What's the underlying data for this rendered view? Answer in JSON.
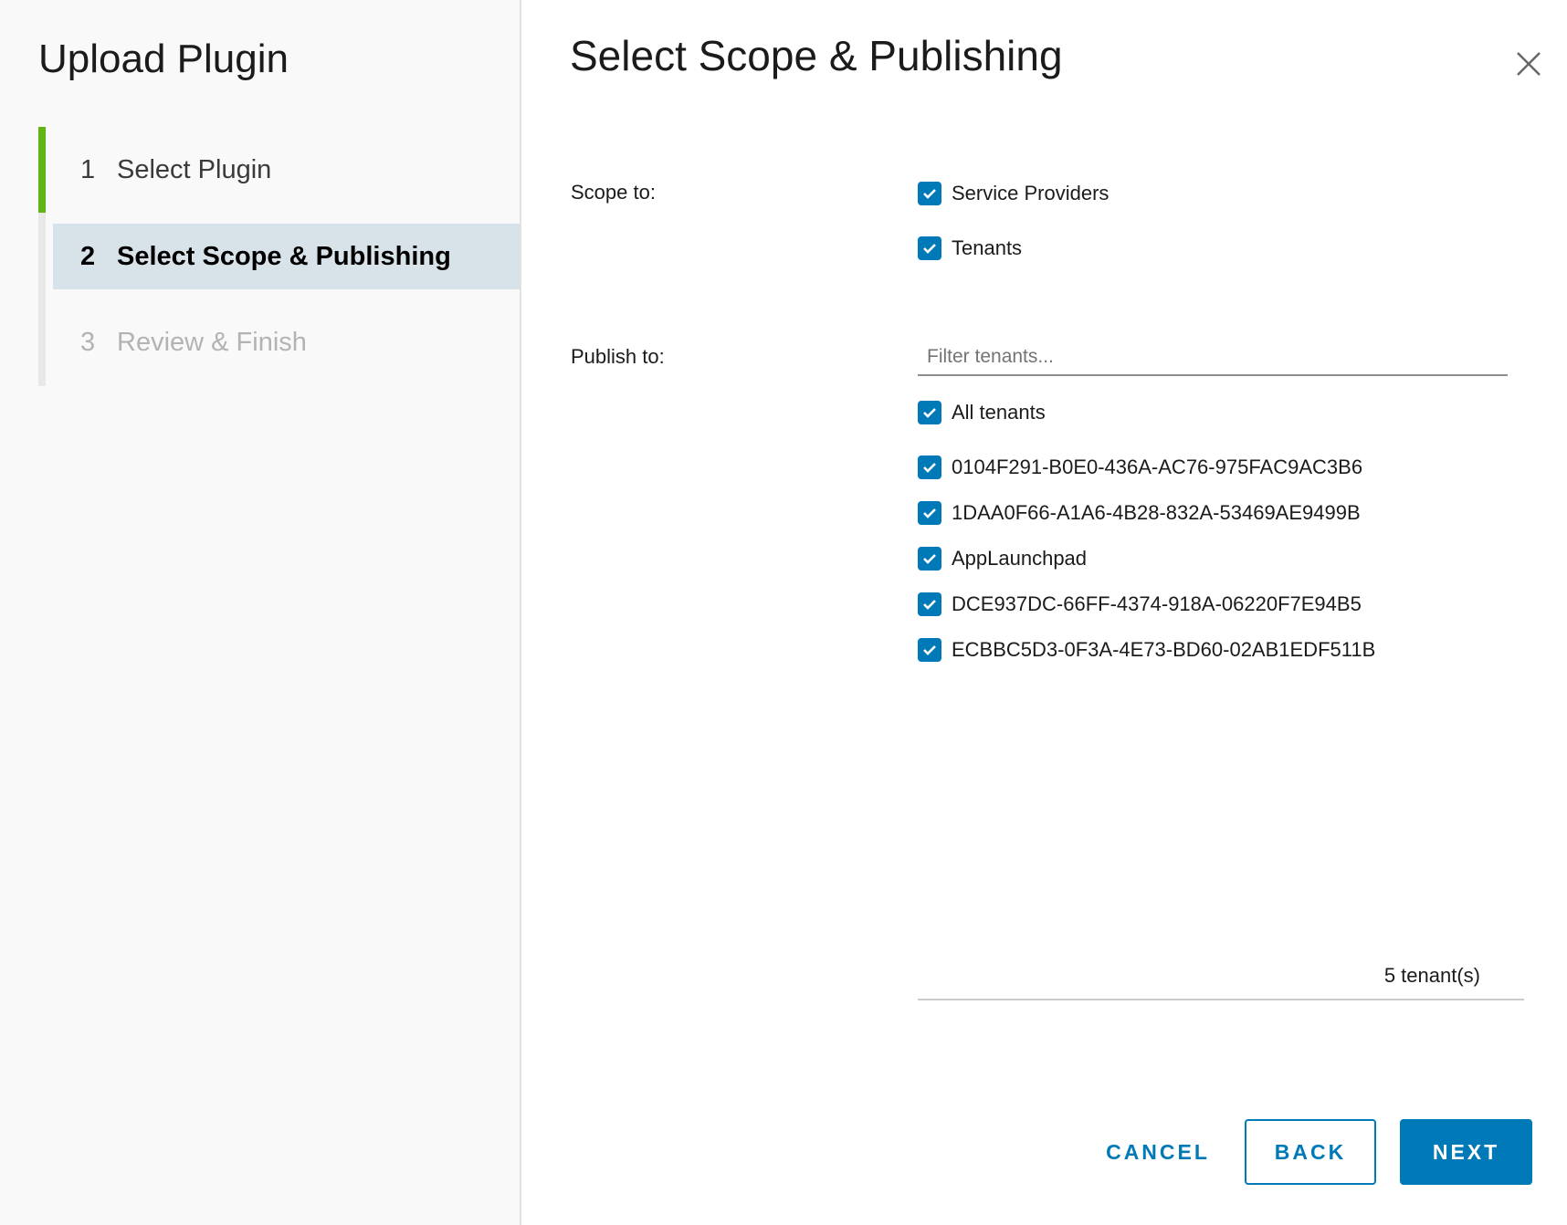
{
  "wizard": {
    "title": "Upload Plugin",
    "steps": [
      {
        "number": "1",
        "label": "Select Plugin",
        "state": "done"
      },
      {
        "number": "2",
        "label": "Select Scope & Publishing",
        "state": "current"
      },
      {
        "number": "3",
        "label": "Review & Finish",
        "state": "todo"
      }
    ]
  },
  "page": {
    "title": "Select Scope & Publishing"
  },
  "scope": {
    "label": "Scope to:",
    "options": [
      {
        "label": "Service Providers",
        "checked": true
      },
      {
        "label": "Tenants",
        "checked": true
      }
    ]
  },
  "publish": {
    "label": "Publish to:",
    "filter_placeholder": "Filter tenants...",
    "filter_value": "",
    "all_tenants": {
      "label": "All tenants",
      "checked": true
    },
    "tenants": [
      {
        "label": "0104F291-B0E0-436A-AC76-975FAC9AC3B6",
        "checked": true
      },
      {
        "label": "1DAA0F66-A1A6-4B28-832A-53469AE9499B",
        "checked": true
      },
      {
        "label": "AppLaunchpad",
        "checked": true
      },
      {
        "label": "DCE937DC-66FF-4374-918A-06220F7E94B5",
        "checked": true
      },
      {
        "label": "ECBBC5D3-0F3A-4E73-BD60-02AB1EDF511B",
        "checked": true
      }
    ],
    "count_text": "5 tenant(s)"
  },
  "footer": {
    "cancel_label": "CANCEL",
    "back_label": "BACK",
    "next_label": "NEXT"
  },
  "colors": {
    "primary": "#0079b8",
    "step_done": "#60b515",
    "step_current_bg": "#d8e3e9"
  },
  "icons": {
    "close": "close-icon",
    "checkbox": "checkmark-icon"
  }
}
